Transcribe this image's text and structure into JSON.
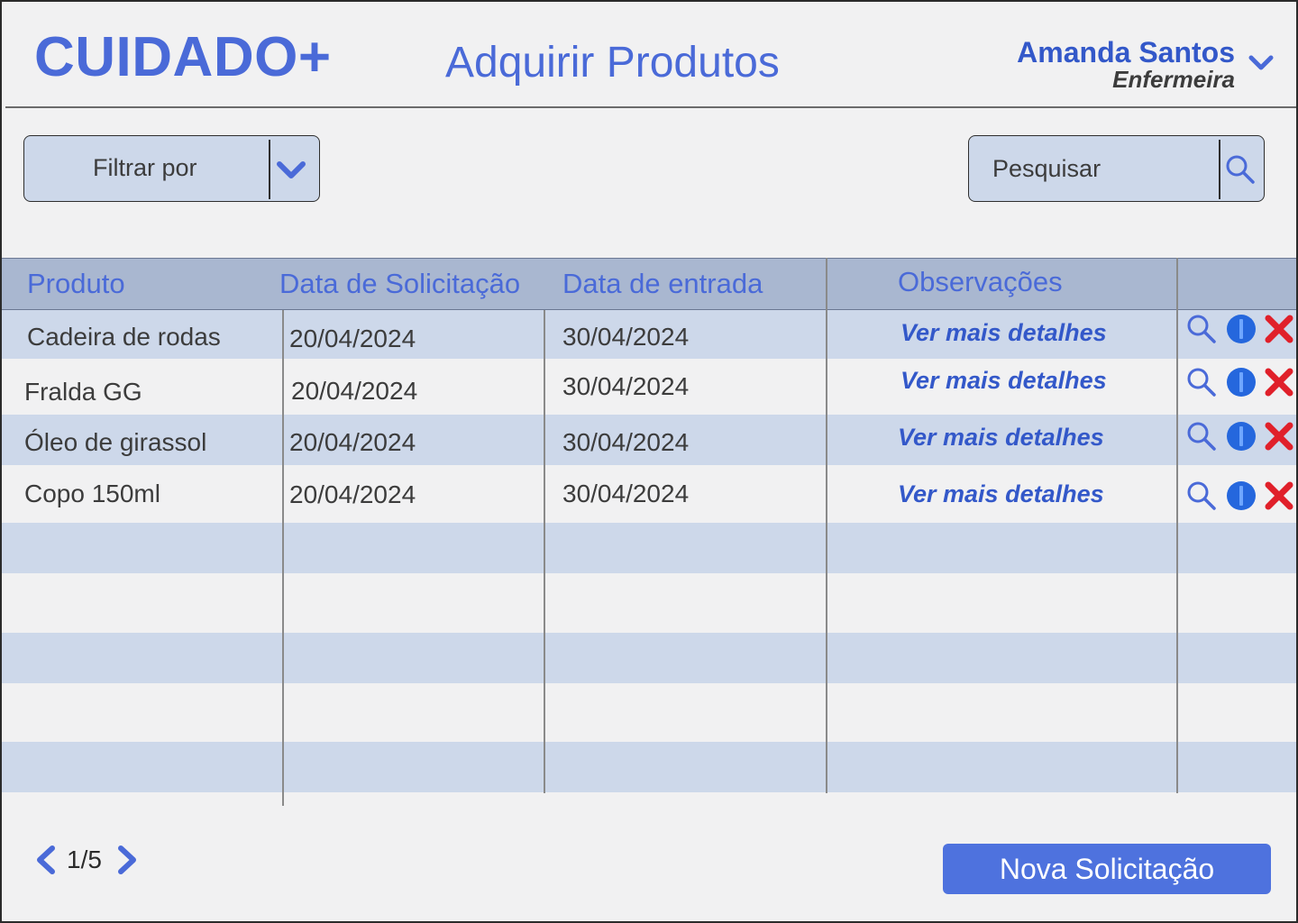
{
  "app": {
    "logo": "CUIDADO+",
    "page_title": "Adquirir Produtos"
  },
  "user": {
    "name": "Amanda Santos",
    "role": "Enfermeira",
    "menu_icon": "chevron-down-icon"
  },
  "filter": {
    "label": "Filtrar por",
    "icon": "chevron-down-icon"
  },
  "search": {
    "placeholder": "Pesquisar",
    "value": "",
    "icon": "search-icon"
  },
  "table": {
    "columns": [
      "Produto",
      "Data de Solicitação",
      "Data de entrada",
      "Observações"
    ],
    "rows": [
      {
        "produto": "Cadeira de rodas",
        "data_solicitacao": "20/04/2024",
        "data_entrada": "30/04/2024",
        "observacoes": "Ver mais detalhes"
      },
      {
        "produto": "Fralda GG",
        "data_solicitacao": "20/04/2024",
        "data_entrada": "30/04/2024",
        "observacoes": "Ver mais detalhes"
      },
      {
        "produto": "Óleo de girassol",
        "data_solicitacao": "20/04/2024",
        "data_entrada": "30/04/2024",
        "observacoes": "Ver mais detalhes"
      },
      {
        "produto": "Copo 150ml",
        "data_solicitacao": "20/04/2024",
        "data_entrada": "30/04/2024",
        "observacoes": "Ver mais detalhes"
      }
    ],
    "row_actions": [
      "search-icon",
      "edit-icon",
      "delete-icon"
    ]
  },
  "pagination": {
    "text": "1/5",
    "prev_icon": "chevron-left-icon",
    "next_icon": "chevron-right-icon"
  },
  "actions": {
    "new_request": "Nova Solicitação"
  },
  "colors": {
    "accent": "#4a6ad8",
    "header_row": "#a9b7d0",
    "shaded_row": "#cdd8ea",
    "background": "#f1f1f2",
    "button": "#4e72de",
    "delete": "#e0202a",
    "edit_gradient": [
      "#2a63d8",
      "#1a7ef0"
    ]
  }
}
